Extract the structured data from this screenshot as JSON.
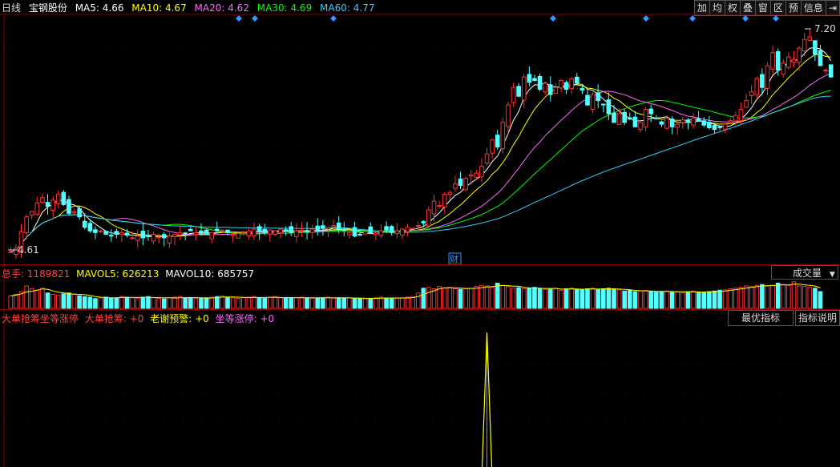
{
  "header": {
    "period": "日线",
    "stock": "宝钢股份",
    "ma5_label": "MA5: 4.66",
    "ma10_label": "MA10: 4.67",
    "ma20_label": "MA20: 4.62",
    "ma30_label": "MA30: 4.69",
    "ma60_label": "MA60: 4.77"
  },
  "toolbar": [
    "加",
    "均",
    "权",
    "叠",
    "窗",
    "区",
    "预",
    "信息",
    "⇥"
  ],
  "colors": {
    "ma5": "#ffffff",
    "ma10": "#ffff00",
    "ma20": "#ff66ff",
    "ma30": "#00ff00",
    "ma60": "#33ccff",
    "up": "#ff3232",
    "down": "#54ffff",
    "grid": "#8b0000",
    "marker": "#3399ff"
  },
  "price_panel": {
    "high_label": "7.20",
    "low_label": "4.61",
    "finance_mark": "财"
  },
  "volume_panel": {
    "total_label": "总手: 1189821",
    "mavol5_label": "MAVOL5: 626213",
    "mavol10_label": "MAVOL10: 685757",
    "dropdown": "成交量"
  },
  "indicator_panel": {
    "title1": "大单抢筹坐等涨停",
    "title2": "大单抢筹: +0",
    "title3": "老谢预警: +0",
    "title4": "坐等涨停: +0",
    "btn_best": "最优指标",
    "btn_explain": "指标说明"
  },
  "chart_data": {
    "type": "candlestick",
    "series": [
      {
        "name": "MA5",
        "value": 4.66
      },
      {
        "name": "MA10",
        "value": 4.67
      },
      {
        "name": "MA20",
        "value": 4.62
      },
      {
        "name": "MA30",
        "value": 4.69
      },
      {
        "name": "MA60",
        "value": 4.77
      }
    ],
    "closes": [
      4.62,
      4.66,
      4.85,
      5.02,
      5.08,
      5.18,
      5.24,
      5.14,
      5.21,
      5.28,
      5.16,
      5.06,
      5.08,
      5.02,
      4.9,
      4.86,
      4.84,
      4.86,
      4.82,
      4.8,
      4.82,
      4.84,
      4.81,
      4.78,
      4.8,
      4.78,
      4.8,
      4.82,
      4.79,
      4.78,
      4.8,
      4.82,
      4.84,
      4.83,
      4.86,
      4.84,
      4.83,
      4.82,
      4.84,
      4.86,
      4.87,
      4.84,
      4.82,
      4.83,
      4.85,
      4.86,
      4.88,
      4.85,
      4.84,
      4.87,
      4.86,
      4.88,
      4.86,
      4.84,
      4.86,
      4.87,
      4.85,
      4.88,
      4.86,
      4.89,
      4.9,
      4.92,
      4.88,
      4.87,
      4.84,
      4.8,
      4.82,
      4.85,
      4.83,
      4.84,
      4.86,
      4.87,
      4.84,
      4.86,
      4.88,
      4.9,
      4.89,
      4.92,
      4.95,
      5.1,
      5.2,
      5.15,
      5.28,
      5.3,
      5.4,
      5.38,
      5.46,
      5.5,
      5.52,
      5.6,
      5.74,
      5.9,
      5.82,
      6.1,
      6.3,
      6.5,
      6.4,
      6.62,
      6.56,
      6.58,
      6.48,
      6.55,
      6.42,
      6.5,
      6.58,
      6.48,
      6.6,
      6.55,
      6.47,
      6.3,
      6.42,
      6.35,
      6.3,
      6.2,
      6.1,
      6.2,
      6.1,
      6.14,
      6.05,
      6.1,
      6.25,
      6.2,
      6.15,
      6.08,
      6.15,
      6.05,
      6.08,
      6.13,
      6.1,
      6.15,
      6.12,
      6.07,
      6.04,
      6.02,
      6.05,
      6.08,
      6.12,
      6.18,
      6.25,
      6.35,
      6.45,
      6.6,
      6.5,
      6.75,
      6.9,
      6.7,
      6.78,
      6.85,
      6.82,
      6.95,
      7.05,
      7.08,
      6.88,
      6.75,
      6.7,
      6.62
    ],
    "volumes": [
      0.45,
      0.5,
      0.6,
      0.8,
      0.7,
      0.65,
      0.72,
      0.55,
      0.5,
      0.48,
      0.52,
      0.55,
      0.5,
      0.45,
      0.42,
      0.4,
      0.35,
      0.38,
      0.4,
      0.36,
      0.38,
      0.42,
      0.4,
      0.38,
      0.36,
      0.4,
      0.42,
      0.38,
      0.36,
      0.34,
      0.38,
      0.4,
      0.42,
      0.38,
      0.36,
      0.35,
      0.37,
      0.38,
      0.4,
      0.42,
      0.44,
      0.4,
      0.38,
      0.36,
      0.38,
      0.4,
      0.42,
      0.38,
      0.36,
      0.4,
      0.42,
      0.38,
      0.37,
      0.36,
      0.38,
      0.4,
      0.38,
      0.36,
      0.37,
      0.38,
      0.4,
      0.36,
      0.38,
      0.37,
      0.38,
      0.36,
      0.35,
      0.34,
      0.36,
      0.38,
      0.4,
      0.37,
      0.35,
      0.36,
      0.38,
      0.4,
      0.42,
      0.55,
      0.72,
      0.75,
      0.7,
      0.78,
      0.72,
      0.75,
      0.7,
      0.68,
      0.7,
      0.72,
      0.78,
      0.82,
      0.8,
      0.75,
      0.9,
      0.82,
      0.78,
      0.72,
      0.74,
      0.7,
      0.72,
      0.75,
      0.7,
      0.68,
      0.7,
      0.72,
      0.65,
      0.7,
      0.72,
      0.68,
      0.66,
      0.7,
      0.72,
      0.68,
      0.7,
      0.72,
      0.68,
      0.66,
      0.62,
      0.65,
      0.6,
      0.62,
      0.64,
      0.6,
      0.58,
      0.6,
      0.62,
      0.6,
      0.58,
      0.56,
      0.6,
      0.62,
      0.58,
      0.56,
      0.6,
      0.62,
      0.65,
      0.66,
      0.7,
      0.72,
      0.75,
      0.8,
      0.78,
      0.82,
      0.85,
      0.8,
      0.82,
      0.9,
      0.85,
      0.82,
      0.95,
      0.8,
      0.78,
      0.75,
      0.72,
      0.6
    ],
    "indicator_spike_index": 90
  }
}
